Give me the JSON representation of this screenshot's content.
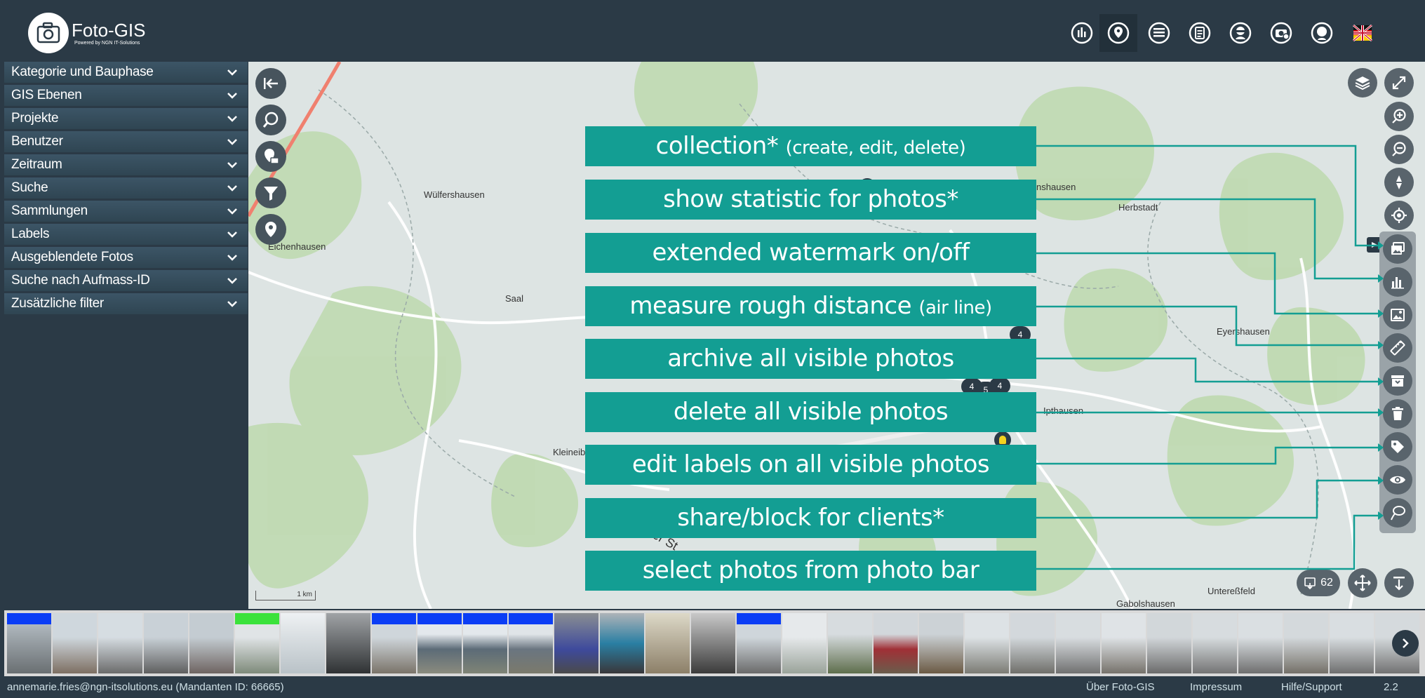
{
  "header": {
    "app_title": "Foto-GIS",
    "app_subtitle": "Powered by NGN IT-Solutions",
    "buttons": [
      "statistics-icon",
      "map-pin-icon",
      "list-icon",
      "clipboard-icon",
      "face-mask-icon",
      "camera-settings-icon",
      "user-icon",
      "flag-icon"
    ]
  },
  "sidebar": {
    "items": [
      {
        "label": "Kategorie und Bauphase"
      },
      {
        "label": "GIS Ebenen"
      },
      {
        "label": "Projekte"
      },
      {
        "label": "Benutzer"
      },
      {
        "label": "Zeitraum"
      },
      {
        "label": "Suche"
      },
      {
        "label": "Sammlungen"
      },
      {
        "label": "Labels"
      },
      {
        "label": "Ausgeblendete Fotos"
      },
      {
        "label": "Suche nach Aufmass-ID"
      },
      {
        "label": "Zusätzliche filter"
      }
    ]
  },
  "map": {
    "places": [
      "Wülfershausen",
      "Eichenhausen",
      "Saal",
      "Kleineib",
      "nshausen",
      "Herbstadt",
      "Eyershausen",
      "Ipthausen",
      "Untereßfeld",
      "Gabolshausen",
      "er St"
    ],
    "clusters": [
      "4",
      "4",
      "5",
      "4"
    ],
    "scale_label": "1 km",
    "photo_count": "62"
  },
  "callouts": [
    {
      "main": "collection*",
      "small": "(create, edit, delete)"
    },
    {
      "main": "show statistic for photos*",
      "small": ""
    },
    {
      "main": "extended watermark on/off",
      "small": ""
    },
    {
      "main": "measure rough distance",
      "small": "(air line)"
    },
    {
      "main": "archive all visible photos",
      "small": ""
    },
    {
      "main": "delete all visible photos",
      "small": ""
    },
    {
      "main": "edit labels on all visible photos",
      "small": ""
    },
    {
      "main": "share/block for clients*",
      "small": ""
    },
    {
      "main": "select photos from photo bar",
      "small": ""
    }
  ],
  "photobar": {
    "tag_colors": {
      "blue": "#0b3df5",
      "green": "#3be23b"
    }
  },
  "footer": {
    "user": "annemarie.fries@ngn-itsolutions.eu (Mandanten ID: 66665)",
    "about": "Über Foto-GIS",
    "impressum": "Impressum",
    "help": "Hilfe/Support",
    "version": "2.2"
  },
  "colors": {
    "accent": "#139e93",
    "header": "#2b3a46"
  }
}
